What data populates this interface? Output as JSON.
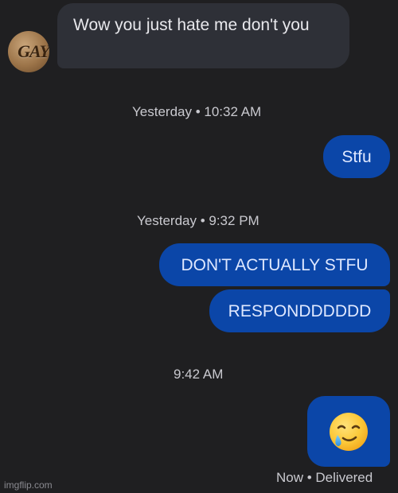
{
  "messages": {
    "incoming_1": "Wow you just hate me don't you",
    "outgoing_1": "Stfu",
    "outgoing_2": "DON'T ACTUALLY STFU",
    "outgoing_3": "RESPONDDDDDD"
  },
  "timestamps": {
    "t1": "Yesterday • 10:32 AM",
    "t2": "Yesterday • 9:32 PM",
    "t3": "9:42 AM"
  },
  "avatar": {
    "text": "GAY"
  },
  "status": {
    "delivered": "Now • Delivered"
  },
  "watermark": "imgflip.com",
  "icons": {
    "last_message_emoji": "smiling-face-with-tear-icon"
  },
  "colors": {
    "background": "#1f1f21",
    "incoming_bubble": "#2e3037",
    "outgoing_bubble": "#0b46a8"
  }
}
